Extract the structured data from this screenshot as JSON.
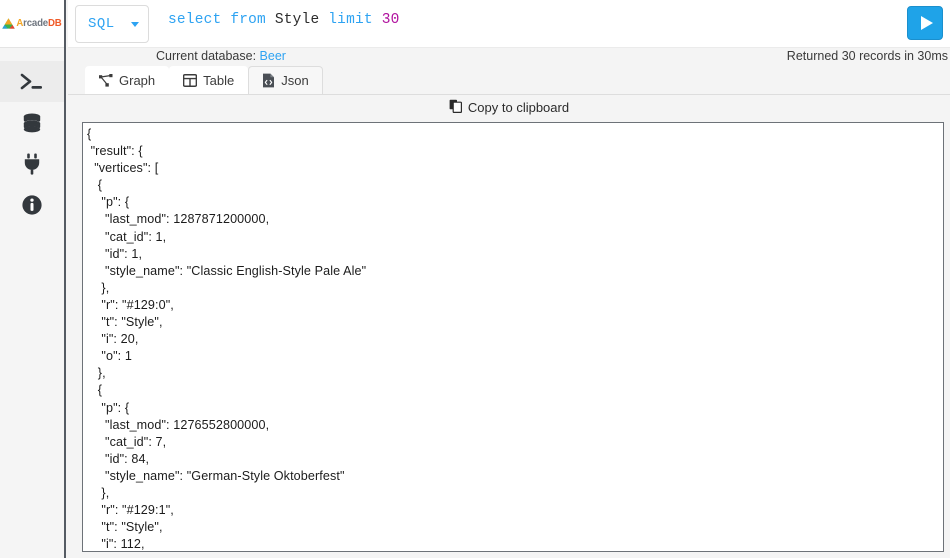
{
  "brand": {
    "name_a": "A",
    "name_rcade": "rcade",
    "name_db": "DB",
    "logo_icon": "arcadedb-mountain-logo"
  },
  "sidebar": {
    "items": [
      {
        "id": "console",
        "icon": "terminal-icon",
        "active": true
      },
      {
        "id": "database",
        "icon": "database-icon",
        "active": false
      },
      {
        "id": "api",
        "icon": "plug-icon",
        "active": false
      },
      {
        "id": "info",
        "icon": "info-circle-icon",
        "active": false
      }
    ]
  },
  "toolbar": {
    "language": "SQL",
    "language_chevron_icon": "chevron-down-icon",
    "query_tokens": [
      {
        "text": "select",
        "type": "keyword"
      },
      {
        "text": " ",
        "type": "plain"
      },
      {
        "text": "from",
        "type": "keyword"
      },
      {
        "text": " ",
        "type": "plain"
      },
      {
        "text": "Style",
        "type": "identifier"
      },
      {
        "text": " ",
        "type": "plain"
      },
      {
        "text": "limit",
        "type": "keyword"
      },
      {
        "text": " ",
        "type": "plain"
      },
      {
        "text": "30",
        "type": "number"
      }
    ],
    "query_plain": "select from Style limit 30",
    "run_icon": "play-icon",
    "run_color": "#1fa3e8"
  },
  "status": {
    "database_prefix": "Current database: ",
    "database_name": "Beer",
    "records_text": "Returned 30 records in 30ms"
  },
  "tabs": [
    {
      "id": "graph",
      "label": "Graph",
      "icon": "graph-nodes-icon",
      "active": false
    },
    {
      "id": "table",
      "label": "Table",
      "icon": "table-grid-icon",
      "active": false
    },
    {
      "id": "json",
      "label": "Json",
      "icon": "json-file-icon",
      "active": true
    }
  ],
  "copy": {
    "label": "Copy to clipboard",
    "icon": "copy-icon"
  },
  "json_result": "{\n \"result\": {\n  \"vertices\": [\n   {\n    \"p\": {\n     \"last_mod\": 1287871200000,\n     \"cat_id\": 1,\n     \"id\": 1,\n     \"style_name\": \"Classic English-Style Pale Ale\"\n    },\n    \"r\": \"#129:0\",\n    \"t\": \"Style\",\n    \"i\": 20,\n    \"o\": 1\n   },\n   {\n    \"p\": {\n     \"last_mod\": 1276552800000,\n     \"cat_id\": 7,\n     \"id\": 84,\n     \"style_name\": \"German-Style Oktoberfest\"\n    },\n    \"r\": \"#129:1\",\n    \"t\": \"Style\",\n    \"i\": 112,",
  "colors": {
    "accent_blue": "#2ea3f2",
    "run_blue": "#1fa3e8",
    "logo_orange": "#f05a28",
    "logo_amber": "#f5a623",
    "page_bg": "#f4f4f4",
    "panel_border": "#6d7278",
    "number_purple": "#b0119e"
  }
}
